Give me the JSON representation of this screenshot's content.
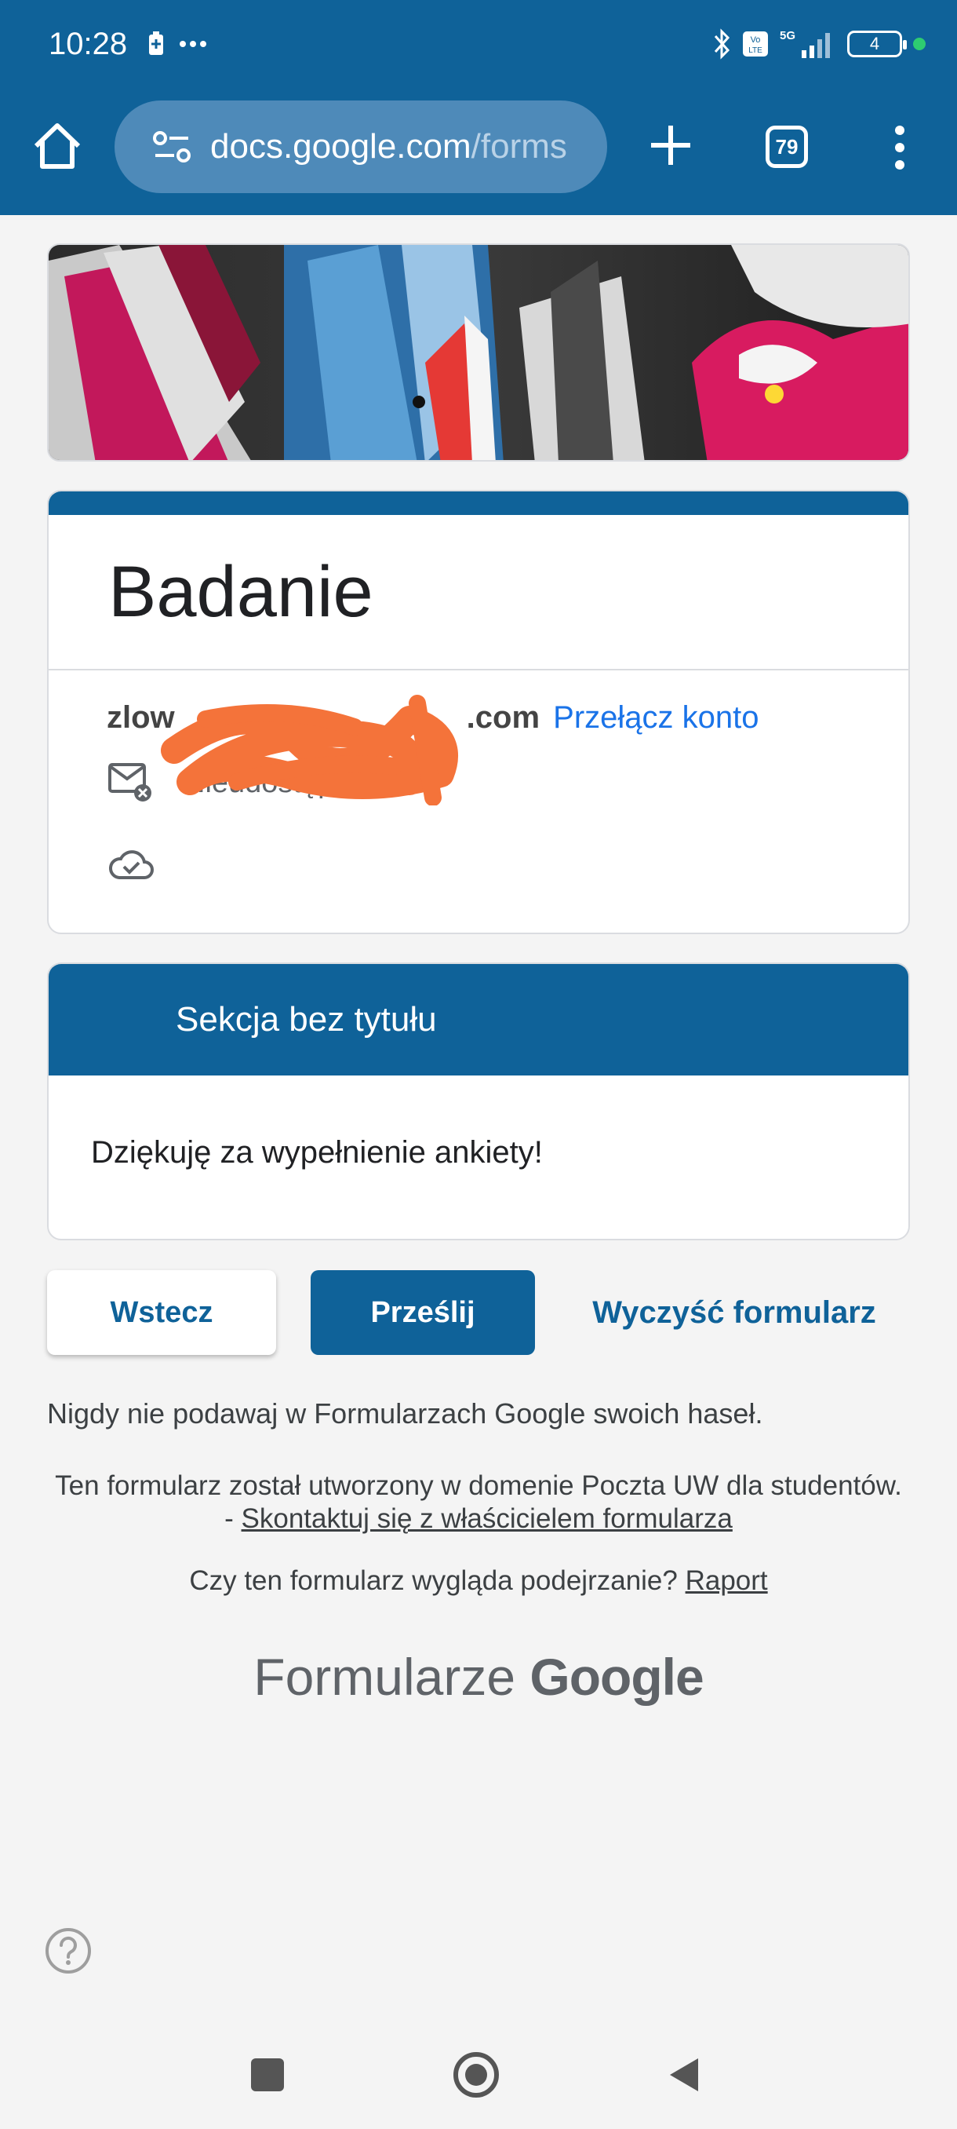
{
  "status_bar": {
    "time": "10:28",
    "battery": "4",
    "network": "5G"
  },
  "browser": {
    "url_host": "docs.google.com",
    "url_path": "/forms",
    "tab_count": "79"
  },
  "form": {
    "title": "Badanie",
    "account_email_visible_start": "zlow",
    "account_email_visible_end": ".com",
    "switch_account": "Przełącz konto",
    "not_shared": "Nieudostępnione",
    "section_title": "Sekcja bez tytułu",
    "thanks_text": "Dziękuję za wypełnienie ankiety!",
    "back_label": "Wstecz",
    "submit_label": "Prześlij",
    "clear_label": "Wyczyść formularz"
  },
  "footer": {
    "warning": "Nigdy nie podawaj w Formularzach Google swoich haseł.",
    "created_prefix": "Ten formularz został utworzony w domenie Poczta UW dla studentów. - ",
    "contact_owner": "Skontaktuj się z właścicielem formularza",
    "suspicious_prefix": "Czy ten formularz wygląda podejrzanie? ",
    "report_link": "Raport",
    "brand_word": "Formularze",
    "brand_google": "Google"
  },
  "colors": {
    "accent": "#0f6299",
    "link": "#1a73e8",
    "background": "#f4f4f4"
  }
}
